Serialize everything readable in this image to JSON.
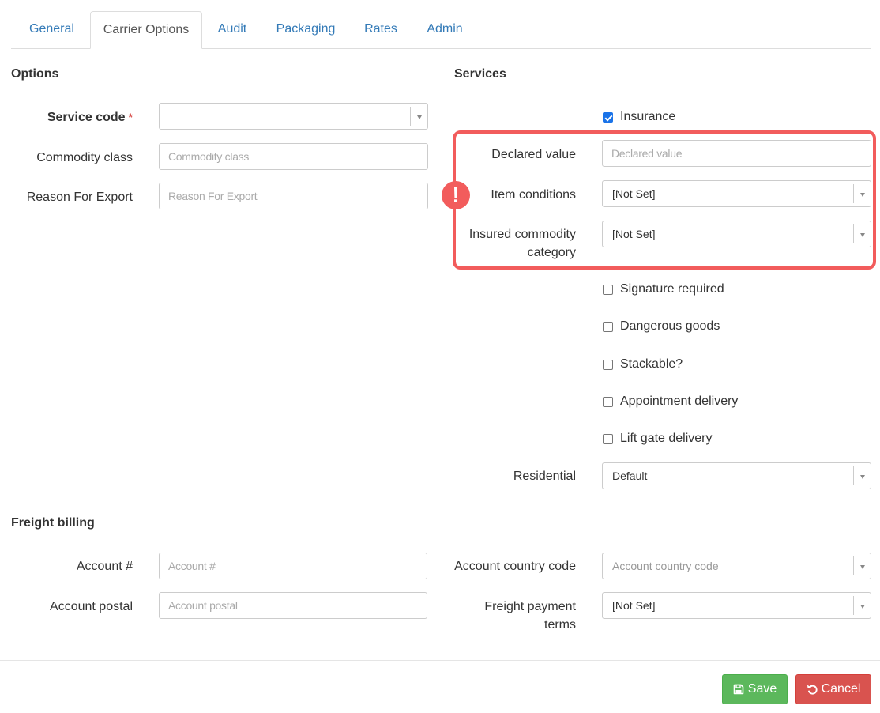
{
  "tabs": [
    {
      "label": "General",
      "active": false
    },
    {
      "label": "Carrier Options",
      "active": true
    },
    {
      "label": "Audit",
      "active": false
    },
    {
      "label": "Packaging",
      "active": false
    },
    {
      "label": "Rates",
      "active": false
    },
    {
      "label": "Admin",
      "active": false
    }
  ],
  "options": {
    "title": "Options",
    "service_code": {
      "label": "Service code",
      "required_mark": "*",
      "value": ""
    },
    "commodity_class": {
      "label": "Commodity class",
      "placeholder": "Commodity class",
      "value": ""
    },
    "reason_for_export": {
      "label": "Reason For Export",
      "placeholder": "Reason For Export",
      "value": ""
    }
  },
  "services": {
    "title": "Services",
    "insurance": {
      "label": "Insurance",
      "checked": true
    },
    "declared_value": {
      "label": "Declared value",
      "placeholder": "Declared value",
      "value": ""
    },
    "item_conditions": {
      "label": "Item conditions",
      "value": "[Not Set]"
    },
    "insured_commodity_category": {
      "label_line1": "Insured commodity",
      "label_line2": "category",
      "value": "[Not Set]"
    },
    "signature_required": {
      "label": "Signature required",
      "checked": false
    },
    "dangerous_goods": {
      "label": "Dangerous goods",
      "checked": false
    },
    "stackable": {
      "label": "Stackable?",
      "checked": false
    },
    "appointment_delivery": {
      "label": "Appointment delivery",
      "checked": false
    },
    "lift_gate_delivery": {
      "label": "Lift gate delivery",
      "checked": false
    },
    "residential": {
      "label": "Residential",
      "value": "Default"
    }
  },
  "freight_billing": {
    "title": "Freight billing",
    "account_number": {
      "label": "Account #",
      "placeholder": "Account #",
      "value": ""
    },
    "account_postal": {
      "label": "Account postal",
      "placeholder": "Account postal",
      "value": ""
    },
    "account_country_code": {
      "label": "Account country code",
      "placeholder": "Account country code"
    },
    "freight_payment_terms": {
      "label_line1": "Freight payment",
      "label_line2": "terms",
      "value": "[Not Set]"
    }
  },
  "highlight": {
    "color": "#f25c5c",
    "alert_symbol": "!"
  },
  "footer": {
    "save_label": "Save",
    "cancel_label": "Cancel"
  },
  "colors": {
    "link": "#337ab7",
    "save": "#5cb85c",
    "cancel": "#d9534f",
    "checkbox": "#1a73e8"
  }
}
